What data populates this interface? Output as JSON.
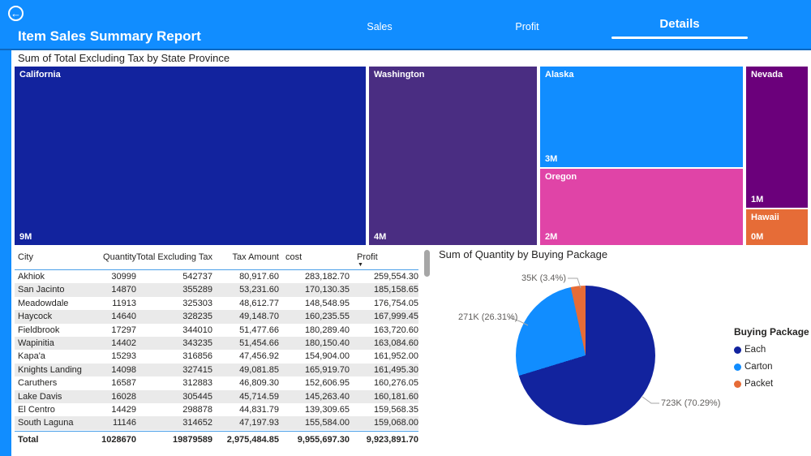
{
  "header": {
    "title": "Item Sales Summary Report",
    "back_icon": "←",
    "tabs": [
      {
        "label": "Sales",
        "active": false
      },
      {
        "label": "Profit",
        "active": false
      },
      {
        "label": "Details",
        "active": true
      }
    ]
  },
  "treemap": {
    "title": "Sum of Total Excluding Tax by State Province",
    "blocks": [
      {
        "name": "California",
        "value": "9M",
        "color": "#12239E"
      },
      {
        "name": "Washington",
        "value": "4M",
        "color": "#4A2D82"
      },
      {
        "name": "Alaska",
        "value": "3M",
        "color": "#118DFF"
      },
      {
        "name": "Oregon",
        "value": "2M",
        "color": "#E044A7"
      },
      {
        "name": "Nevada",
        "value": "1M",
        "color": "#6B007B"
      },
      {
        "name": "Hawaii",
        "value": "0M",
        "color": "#E66C37"
      }
    ]
  },
  "table": {
    "columns": [
      "City",
      "Quantity",
      "Total Excluding Tax",
      "Tax Amount",
      "cost",
      "Profit"
    ],
    "sort_column": "Profit",
    "sort_icon": "▼",
    "rows": [
      [
        "Akhiok",
        "30999",
        "542737",
        "80,917.60",
        "283,182.70",
        "259,554.30"
      ],
      [
        "San Jacinto",
        "14870",
        "355289",
        "53,231.60",
        "170,130.35",
        "185,158.65"
      ],
      [
        "Meadowdale",
        "11913",
        "325303",
        "48,612.77",
        "148,548.95",
        "176,754.05"
      ],
      [
        "Haycock",
        "14640",
        "328235",
        "49,148.70",
        "160,235.55",
        "167,999.45"
      ],
      [
        "Fieldbrook",
        "17297",
        "344010",
        "51,477.66",
        "180,289.40",
        "163,720.60"
      ],
      [
        "Wapinitia",
        "14402",
        "343235",
        "51,454.66",
        "180,150.40",
        "163,084.60"
      ],
      [
        "Kapa'a",
        "15293",
        "316856",
        "47,456.92",
        "154,904.00",
        "161,952.00"
      ],
      [
        "Knights Landing",
        "14098",
        "327415",
        "49,081.85",
        "165,919.70",
        "161,495.30"
      ],
      [
        "Caruthers",
        "16587",
        "312883",
        "46,809.30",
        "152,606.95",
        "160,276.05"
      ],
      [
        "Lake Davis",
        "16028",
        "305445",
        "45,714.59",
        "145,263.40",
        "160,181.60"
      ],
      [
        "El Centro",
        "14429",
        "298878",
        "44,831.79",
        "139,309.65",
        "159,568.35"
      ],
      [
        "South Laguna",
        "11146",
        "314652",
        "47,197.93",
        "155,584.00",
        "159,068.00"
      ]
    ],
    "total_row": [
      "Total",
      "1028670",
      "19879589",
      "2,975,484.85",
      "9,955,697.30",
      "9,923,891.70"
    ]
  },
  "pie": {
    "title": "Sum of Quantity by Buying Package",
    "slices": [
      {
        "name": "Each",
        "callout": "723K (70.29%)",
        "pct": 70.29,
        "color": "#12239E"
      },
      {
        "name": "Carton",
        "callout": "271K (26.31%)",
        "pct": 26.31,
        "color": "#118DFF"
      },
      {
        "name": "Packet",
        "callout": "35K (3.4%)",
        "pct": 3.4,
        "color": "#E66C37"
      }
    ],
    "legend": {
      "title": "Buying Package",
      "items": [
        {
          "label": "Each",
          "color": "#12239E"
        },
        {
          "label": "Carton",
          "color": "#118DFF"
        },
        {
          "label": "Packet",
          "color": "#E66C37"
        }
      ]
    }
  },
  "chart_data": [
    {
      "type": "treemap",
      "title": "Sum of Total Excluding Tax by State Province",
      "categories": [
        "California",
        "Washington",
        "Alaska",
        "Oregon",
        "Nevada",
        "Hawaii"
      ],
      "value_labels": [
        "9M",
        "4M",
        "3M",
        "2M",
        "1M",
        "0M"
      ],
      "colors": [
        "#12239E",
        "#4A2D82",
        "#118DFF",
        "#E044A7",
        "#6B007B",
        "#E66C37"
      ]
    },
    {
      "type": "pie",
      "title": "Sum of Quantity by Buying Package",
      "categories": [
        "Each",
        "Carton",
        "Packet"
      ],
      "values": [
        723000,
        271000,
        35000
      ],
      "percentages": [
        70.29,
        26.31,
        3.4
      ],
      "data_labels": [
        "723K (70.29%)",
        "271K (26.31%)",
        "35K (3.4%)"
      ],
      "legend_title": "Buying Package",
      "legend_position": "right",
      "colors": [
        "#12239E",
        "#118DFF",
        "#E66C37"
      ]
    },
    {
      "type": "table",
      "title": "City sales detail",
      "columns": [
        "City",
        "Quantity",
        "Total Excluding Tax",
        "Tax Amount",
        "cost",
        "Profit"
      ],
      "rows": [
        [
          "Akhiok",
          30999,
          542737,
          80917.6,
          283182.7,
          259554.3
        ],
        [
          "San Jacinto",
          14870,
          355289,
          53231.6,
          170130.35,
          185158.65
        ],
        [
          "Meadowdale",
          11913,
          325303,
          48612.77,
          148548.95,
          176754.05
        ],
        [
          "Haycock",
          14640,
          328235,
          49148.7,
          160235.55,
          167999.45
        ],
        [
          "Fieldbrook",
          17297,
          344010,
          51477.66,
          180289.4,
          163720.6
        ],
        [
          "Wapinitia",
          14402,
          343235,
          51454.66,
          180150.4,
          163084.6
        ],
        [
          "Kapa'a",
          15293,
          316856,
          47456.92,
          154904.0,
          161952.0
        ],
        [
          "Knights Landing",
          14098,
          327415,
          49081.85,
          165919.7,
          161495.3
        ],
        [
          "Caruthers",
          16587,
          312883,
          46809.3,
          152606.95,
          160276.05
        ],
        [
          "Lake Davis",
          16028,
          305445,
          45714.59,
          145263.4,
          160181.6
        ],
        [
          "El Centro",
          14429,
          298878,
          44831.79,
          139309.65,
          159568.35
        ],
        [
          "South Laguna",
          11146,
          314652,
          47197.93,
          155584.0,
          159068.0
        ]
      ],
      "total": [
        "Total",
        1028670,
        19879589,
        2975484.85,
        9955697.3,
        9923891.7
      ]
    }
  ]
}
